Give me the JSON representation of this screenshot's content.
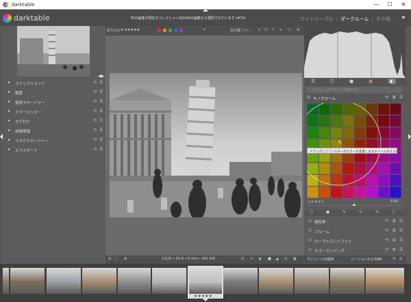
{
  "app": {
    "title": "darktable",
    "brand": "darktable",
    "header_message": "35の画像が現在のコレクション内の49の画像から選択されています (#74)",
    "window_controls": {
      "minimize": "—",
      "maximize": "☐",
      "close": "✕"
    }
  },
  "views": {
    "lighttable": "ライトテーブル",
    "darkroom": "ダークルーム",
    "other": "その他"
  },
  "left_panel": {
    "items": [
      {
        "label": "スナップショット"
      },
      {
        "label": "履歴"
      },
      {
        "label": "複製マネージャー"
      },
      {
        "label": "カラーピッカー"
      },
      {
        "label": "タグ付け"
      },
      {
        "label": "画像情報"
      },
      {
        "label": "マスクマネージャー"
      },
      {
        "label": "エクスポート"
      }
    ]
  },
  "toolbar": {
    "filter_label": "絞り込み",
    "stars": "⊘ ★★★★★",
    "sort_label": "並び順 ファ...",
    "color_labels": [
      "#d33",
      "#d33",
      "#3a3",
      "#36c",
      "#a3c"
    ]
  },
  "bottombar": {
    "exif": "1/125 • f/5.6 • 6 mm • ISO 100",
    "left_icons": [
      "☰",
      "⛶",
      "⚙"
    ],
    "right_icons": [
      "⊡",
      "☼",
      "◐",
      "■",
      "▲",
      "☷",
      "▦"
    ]
  },
  "right_panel": {
    "tab_icons": [
      "☰",
      "⏻",
      "●",
      "◉",
      "◐"
    ],
    "search_placeholder": "モジュールをグループで検索する",
    "module_title": "モノクローム",
    "tooltip": "ドラッグしてフィルターのカラーを変更しますホイールのスクロールで範囲上のカラーフィルターを調整します",
    "highlights_label": "ハイライト",
    "highlights_value": "0.00",
    "modules": [
      {
        "label": "極所等"
      },
      {
        "label": "ブルーム"
      },
      {
        "label": "ローカルコントラスト"
      },
      {
        "label": "カラーマッピング"
      }
    ],
    "group_label": "モジュールの順序",
    "group_value": "バージョン3.0 RAW"
  },
  "filmstrip": {
    "selected_rating": "★★★★★",
    "thumbnail_count": 12
  }
}
